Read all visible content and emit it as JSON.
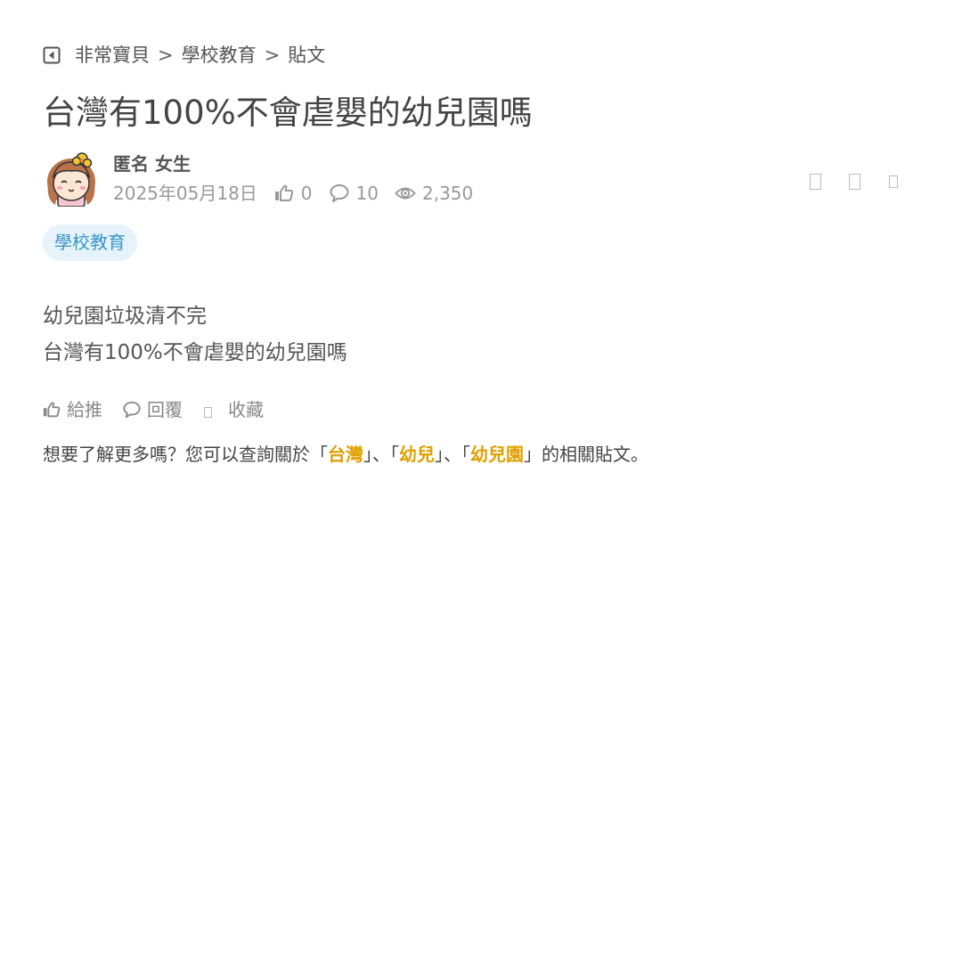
{
  "breadcrumb": {
    "items": [
      "非常寶貝",
      "學校教育",
      "貼文"
    ],
    "separator": ">"
  },
  "post": {
    "title": "台灣有100%不會虐嬰的幼兒園嗎",
    "author": "匿名 女生",
    "date": "2025年05月18日",
    "likes": "0",
    "comments": "10",
    "views": "2,350",
    "tag": "學校教育",
    "body_lines": [
      "幼兒園垃圾清不完",
      "台灣有100%不會虐嬰的幼兒園嗎"
    ]
  },
  "actions": {
    "like_label": "給推",
    "reply_label": "回覆",
    "save_label": "收藏"
  },
  "related": {
    "prefix": "想要了解更多嗎？您可以查詢關於",
    "open_quote": "「",
    "close_quote": "」",
    "comma": "、",
    "keywords": [
      "台灣",
      "幼兒",
      "幼兒園"
    ],
    "suffix": "的相關貼文。"
  },
  "icons": {
    "back": "back-square-icon",
    "like": "thumbs-up-icon",
    "comment": "speech-bubble-icon",
    "views": "eye-icon",
    "avatar": "girl-avatar-icon"
  },
  "colors": {
    "tag_bg": "#e6f3fb",
    "tag_text": "#3a94c7",
    "keyword": "#e0a000",
    "muted": "#999999"
  }
}
